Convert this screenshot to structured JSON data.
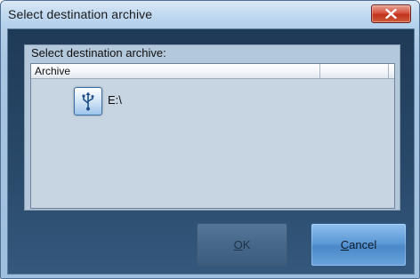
{
  "window": {
    "title": "Select destination archive"
  },
  "titlebar": {
    "close_icon": "close-x-icon",
    "close_color": "#c7402a"
  },
  "group": {
    "label": "Select destination archive:"
  },
  "list": {
    "columns": [
      "Archive",
      ""
    ],
    "items": [
      {
        "label": "E:\\",
        "icon": "usb-drive-icon"
      }
    ]
  },
  "buttons": {
    "ok": {
      "mnemonic": "O",
      "rest": "K",
      "enabled": false
    },
    "cancel": {
      "mnemonic": "C",
      "rest": "ancel",
      "enabled": true
    }
  },
  "colors": {
    "client_background": "#2a4a6b",
    "accent_button": "#5d9ad6"
  }
}
